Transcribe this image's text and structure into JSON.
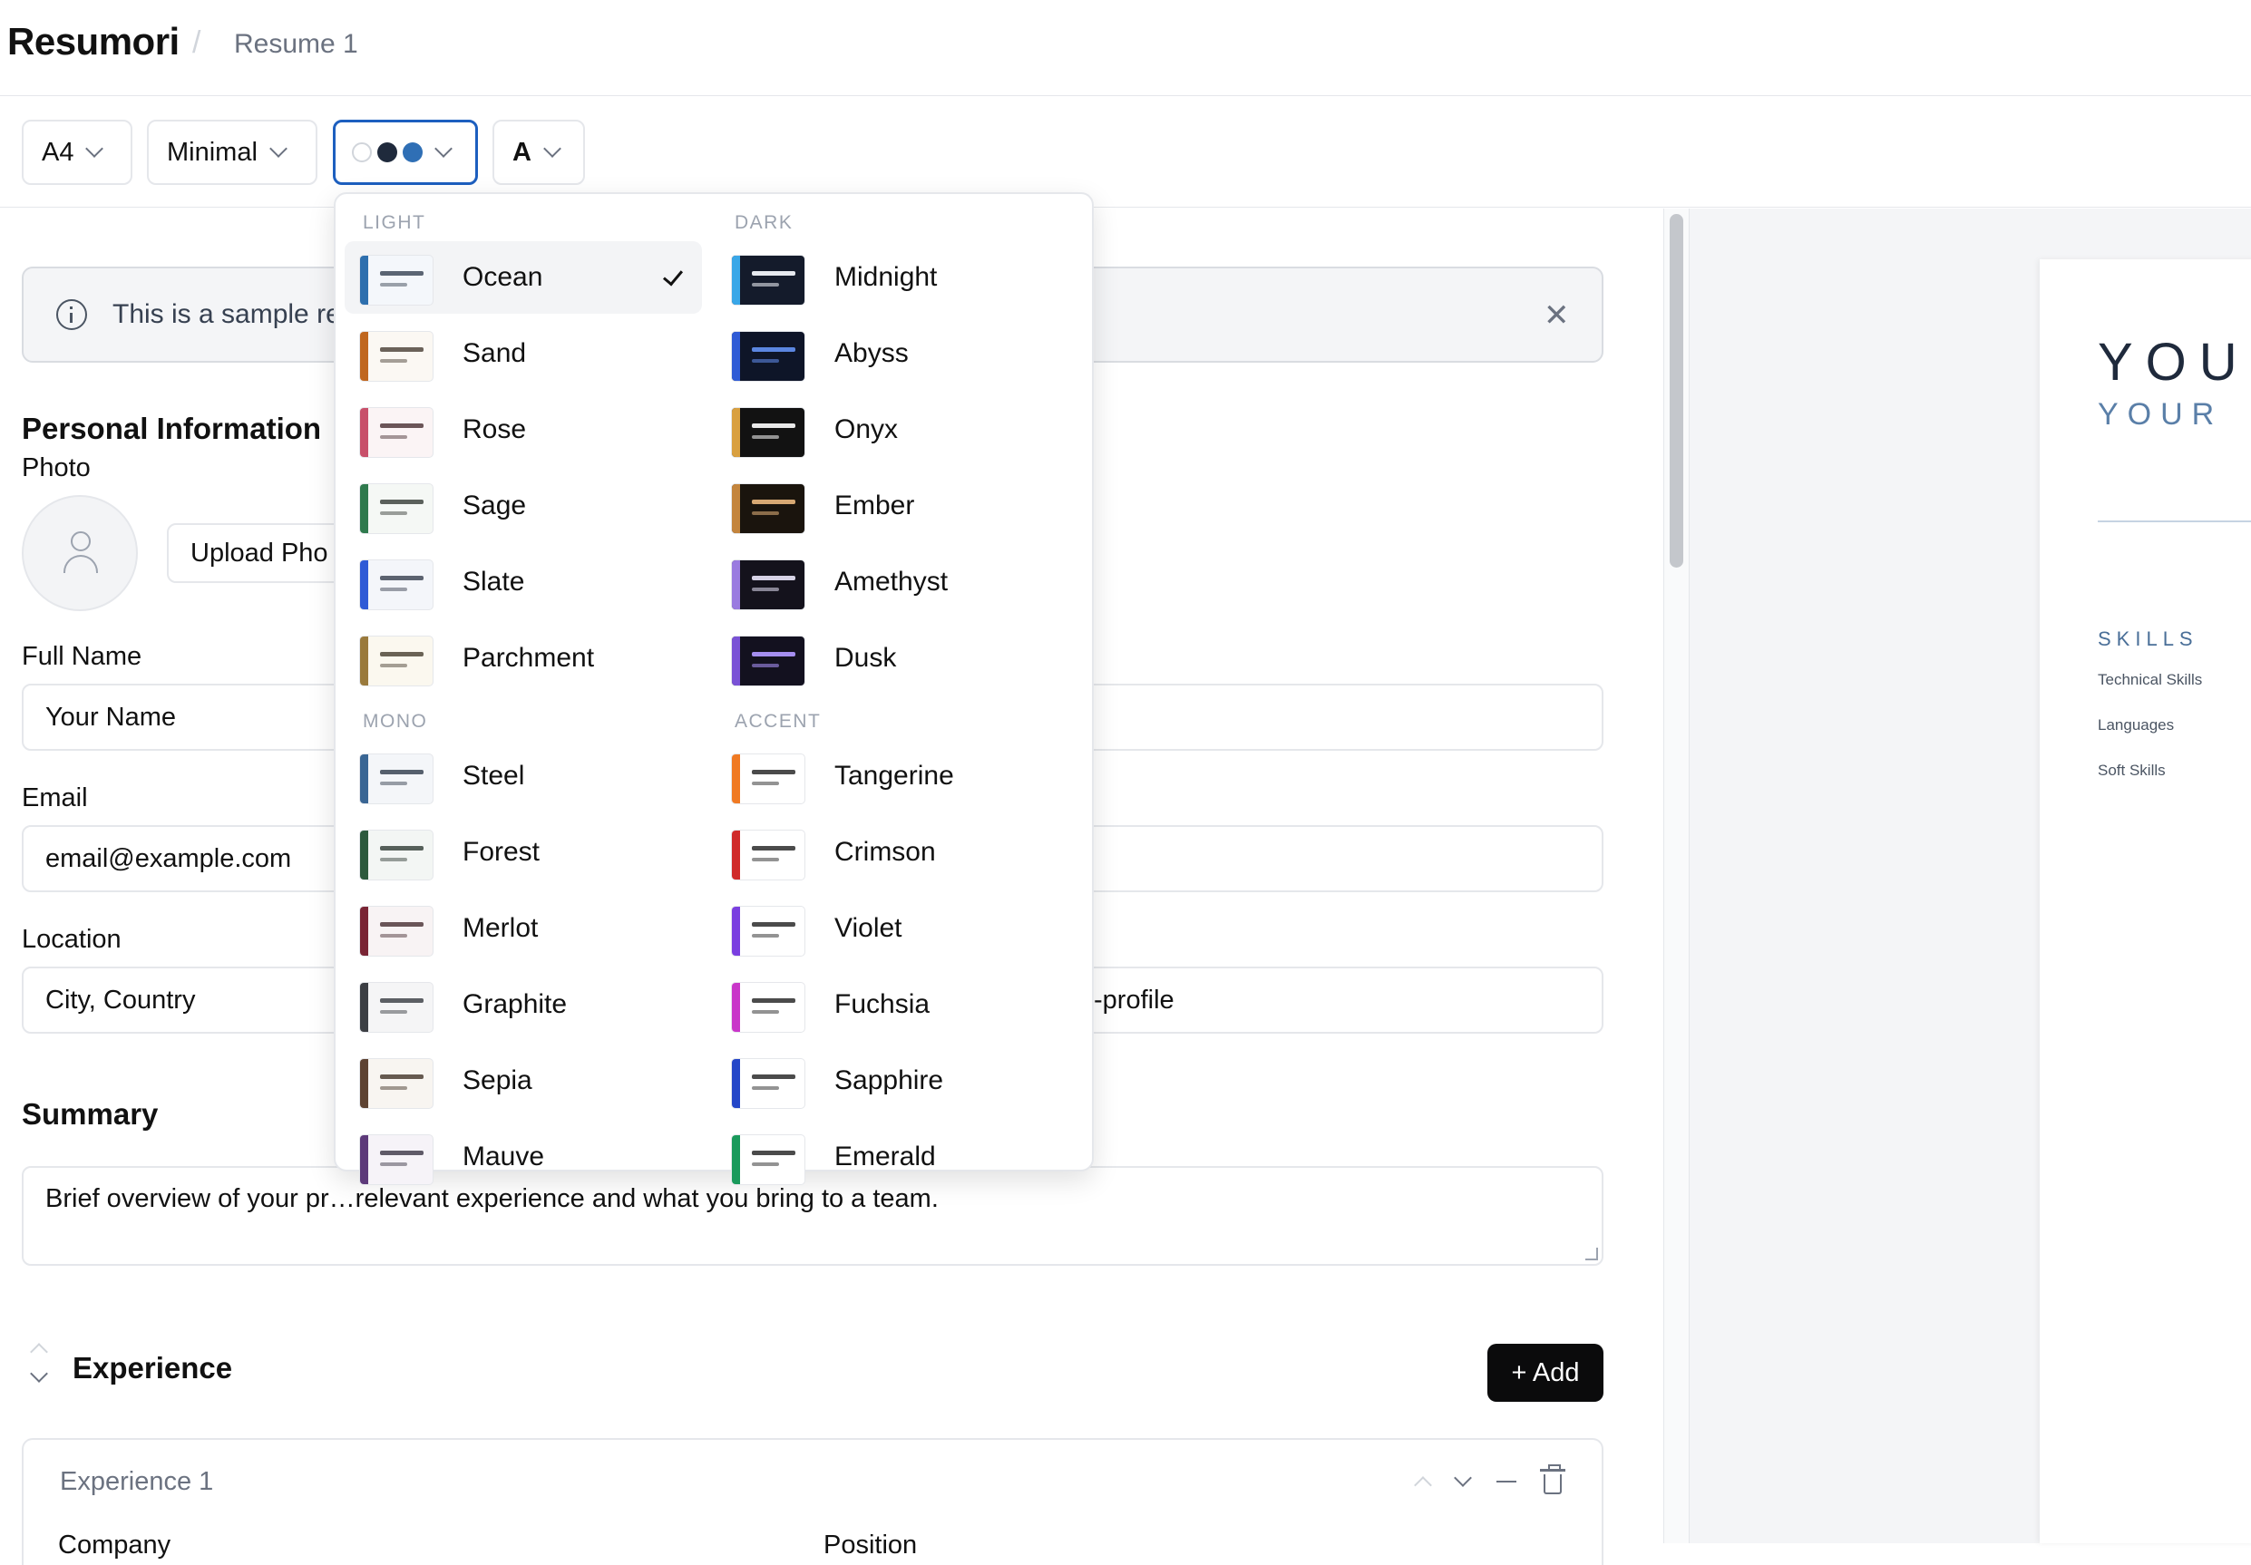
{
  "header": {
    "logo": "Resumori",
    "separator": "/",
    "breadcrumb": "Resume 1"
  },
  "toolbar": {
    "paper_size": "A4",
    "template": "Minimal",
    "theme_colors": [
      "#ffffff",
      "#1f2a3c",
      "#2f6fb5"
    ],
    "font_button": "A"
  },
  "banner": {
    "text": "This is a sample re"
  },
  "form": {
    "personal_title": "Personal Information",
    "photo_label": "Photo",
    "upload_label": "Upload Pho",
    "full_name_label": "Full Name",
    "full_name_placeholder": "Your Name",
    "email_label": "Email",
    "email_placeholder": "email@example.com",
    "location_label": "Location",
    "location_placeholder": "City, Country",
    "linkedin_fragment": "-profile",
    "summary_title": "Summary",
    "summary_placeholder": "Brief overview of your pr…relevant experience and what you bring to a team.",
    "experience_title": "Experience",
    "add_label": "+ Add",
    "experience_card_title": "Experience 1",
    "company_label": "Company",
    "position_label": "Position"
  },
  "preview": {
    "name": "YOU",
    "subtitle": "YOUR",
    "skills_heading": "SKILLS",
    "skills": [
      "Technical Skills",
      "Languages",
      "Soft Skills"
    ]
  },
  "dropdown": {
    "groups": {
      "light": "LIGHT",
      "dark": "DARK",
      "mono": "MONO",
      "accent": "ACCENT"
    },
    "light": [
      {
        "name": "Ocean",
        "accent": "#2e6fae",
        "bg": "#f4f7fb",
        "line": "#5b6573",
        "selected": true
      },
      {
        "name": "Sand",
        "accent": "#c0671f",
        "bg": "#fbf8f3",
        "line": "#6b6259"
      },
      {
        "name": "Rose",
        "accent": "#c8506a",
        "bg": "#fbf4f5",
        "line": "#6b5558"
      },
      {
        "name": "Sage",
        "accent": "#2f7a4d",
        "bg": "#f5f8f5",
        "line": "#5b615c"
      },
      {
        "name": "Slate",
        "accent": "#2f5bd6",
        "bg": "#f4f6fa",
        "line": "#5c6370"
      },
      {
        "name": "Parchment",
        "accent": "#9a7a3c",
        "bg": "#fbf8ef",
        "line": "#6a6355"
      }
    ],
    "dark": [
      {
        "name": "Midnight",
        "accent": "#39a7e8",
        "bg": "#141b2b",
        "line": "#e6e9ef"
      },
      {
        "name": "Abyss",
        "accent": "#2f5bd6",
        "bg": "#0e1528",
        "line": "#5b86e0"
      },
      {
        "name": "Onyx",
        "accent": "#d9a040",
        "bg": "#121212",
        "line": "#e8e8e8"
      },
      {
        "name": "Ember",
        "accent": "#c4853d",
        "bg": "#1a140d",
        "line": "#d7a873"
      },
      {
        "name": "Amethyst",
        "accent": "#9a7be0",
        "bg": "#14121c",
        "line": "#d6d2e6"
      },
      {
        "name": "Dusk",
        "accent": "#7a52d6",
        "bg": "#13111f",
        "line": "#a58ef0"
      }
    ],
    "mono": [
      {
        "name": "Steel",
        "accent": "#3a6694",
        "bg": "#f4f6f9",
        "line": "#56606d"
      },
      {
        "name": "Forest",
        "accent": "#2d5a3d",
        "bg": "#f3f6f4",
        "line": "#56605a"
      },
      {
        "name": "Merlot",
        "accent": "#7a2535",
        "bg": "#f8f3f4",
        "line": "#6a5558"
      },
      {
        "name": "Graphite",
        "accent": "#3c3f44",
        "bg": "#f5f5f6",
        "line": "#5c5f64"
      },
      {
        "name": "Sepia",
        "accent": "#5e4332",
        "bg": "#f8f5f1",
        "line": "#665a50"
      },
      {
        "name": "Mauve",
        "accent": "#5d3a7a",
        "bg": "#f6f3f8",
        "line": "#5f5a68"
      }
    ],
    "accent": [
      {
        "name": "Tangerine",
        "accent": "#f07a23",
        "bg": "#ffffff",
        "line": "#4b4b4b"
      },
      {
        "name": "Crimson",
        "accent": "#d02a2a",
        "bg": "#ffffff",
        "line": "#4b4b4b"
      },
      {
        "name": "Violet",
        "accent": "#7a3fe0",
        "bg": "#ffffff",
        "line": "#4b4b4b"
      },
      {
        "name": "Fuchsia",
        "accent": "#c936c9",
        "bg": "#ffffff",
        "line": "#4b4b4b"
      },
      {
        "name": "Sapphire",
        "accent": "#2446c8",
        "bg": "#ffffff",
        "line": "#4b4b4b"
      },
      {
        "name": "Emerald",
        "accent": "#1a9a5c",
        "bg": "#ffffff",
        "line": "#4b4b4b"
      }
    ]
  }
}
